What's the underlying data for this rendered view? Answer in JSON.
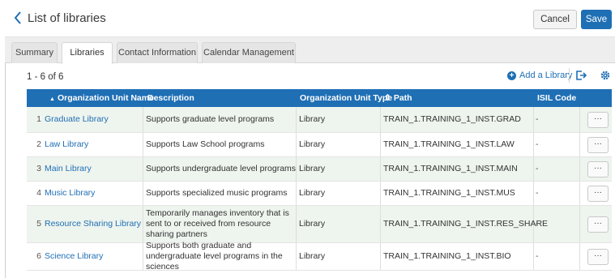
{
  "header": {
    "title": "List of libraries",
    "cancel_label": "Cancel",
    "save_label": "Save"
  },
  "tabs": [
    {
      "label": "Summary",
      "active": false
    },
    {
      "label": "Libraries",
      "active": true
    },
    {
      "label": "Contact Information",
      "active": false
    },
    {
      "label": "Calendar Management",
      "active": false
    }
  ],
  "toolbar": {
    "count_text": "1 - 6 of 6",
    "add_label": "Add a Library"
  },
  "table": {
    "columns": [
      "Organization Unit Name",
      "Description",
      "Organization Unit Type",
      "Path",
      "ISIL Code"
    ],
    "sort_asc_glyph": "▲",
    "sort_glyph": "⇕",
    "more_label": "···",
    "rows": [
      {
        "num": "1",
        "name": "Graduate Library",
        "description": "Supports graduate level programs",
        "type": "Library",
        "path": "TRAIN_1.TRAINING_1_INST.GRAD",
        "isil": "-"
      },
      {
        "num": "2",
        "name": "Law Library",
        "description": "Supports Law School programs",
        "type": "Library",
        "path": "TRAIN_1.TRAINING_1_INST.LAW",
        "isil": "-"
      },
      {
        "num": "3",
        "name": "Main Library",
        "description": "Supports undergraduate level programs",
        "type": "Library",
        "path": "TRAIN_1.TRAINING_1_INST.MAIN",
        "isil": "-"
      },
      {
        "num": "4",
        "name": "Music Library",
        "description": "Supports specialized music programs",
        "type": "Library",
        "path": "TRAIN_1.TRAINING_1_INST.MUS",
        "isil": "-"
      },
      {
        "num": "5",
        "name": "Resource Sharing Library",
        "description": "Temporarily manages inventory that is sent to or received from resource sharing partners",
        "type": "Library",
        "path": "TRAIN_1.TRAINING_1_INST.RES_SHARE",
        "isil": "-"
      },
      {
        "num": "6",
        "name": "Science Library",
        "description": "Supports both graduate and undergraduate level programs in the sciences",
        "type": "Library",
        "path": "TRAIN_1.TRAINING_1_INST.BIO",
        "isil": "-"
      }
    ]
  },
  "colors": {
    "accent": "#1f6fb5",
    "row_alt": "#eef4ee",
    "tab_bar": "#eeeeee"
  }
}
